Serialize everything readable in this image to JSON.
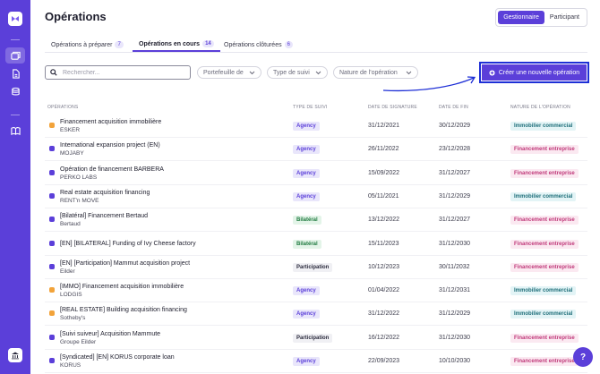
{
  "colors": {
    "accent": "#5b3fd9",
    "highlight": "#1e2fd6",
    "agency_bg": "#e9e6fb",
    "agency_fg": "#5b3fd9",
    "bilateral_bg": "#e3f4e8",
    "bilateral_fg": "#1f7a3f",
    "participation_bg": "#f0f0f4",
    "participation_fg": "#2a2a3c",
    "immo_bg": "#e3f4f6",
    "immo_fg": "#1f6f7a",
    "finent_bg": "#fbe9f1",
    "finent_fg": "#c0397a",
    "icon_orange": "#f2a33a",
    "icon_purple": "#5b3fd9"
  },
  "sidebar": {
    "logo_icon": "logo-icon",
    "items": [
      {
        "icon": "operations-icon",
        "active": true
      },
      {
        "icon": "document-icon",
        "active": false
      },
      {
        "icon": "database-icon",
        "active": false
      },
      {
        "icon": "book-icon",
        "active": false
      }
    ],
    "bottom_icon": "bank-icon"
  },
  "page": {
    "title": "Opérations"
  },
  "role_toggle": {
    "options": [
      "Gestionnaire",
      "Participant"
    ],
    "selected": "Gestionnaire"
  },
  "tabs": [
    {
      "label": "Opérations à préparer",
      "count": "7"
    },
    {
      "label": "Opérations en cours",
      "count": "14",
      "active": true
    },
    {
      "label": "Opérations clôturées",
      "count": "6"
    }
  ],
  "search": {
    "placeholder": "Rechercher..."
  },
  "filters": [
    "Portefeuille de",
    "Type de suivi",
    "Nature de l'opération"
  ],
  "cta": {
    "label": "Créer une nouvelle opération"
  },
  "table": {
    "columns": [
      "OPÉRATIONS",
      "TYPE DE SUIVI",
      "DATE DE SIGNATURE",
      "DATE DE FIN",
      "NATURE DE L'OPÉRATION"
    ],
    "rows": [
      {
        "name": "Financement acquisition immobilière",
        "sub": "ESKER",
        "icon": "orange",
        "type": "Agency",
        "sign": "31/12/2021",
        "end": "30/12/2029",
        "nature": "Immobilier commercial"
      },
      {
        "name": "International expansion project (EN)",
        "sub": "MOJABY",
        "icon": "purple",
        "type": "Agency",
        "sign": "26/11/2022",
        "end": "23/12/2028",
        "nature": "Financement entreprise"
      },
      {
        "name": "Opération de financement BARBERA",
        "sub": "PERKO LABS",
        "icon": "purple",
        "type": "Agency",
        "sign": "15/09/2022",
        "end": "31/12/2027",
        "nature": "Financement entreprise"
      },
      {
        "name": "Real estate acquisition financing",
        "sub": "RENT'n MOVE",
        "icon": "purple",
        "type": "Agency",
        "sign": "05/11/2021",
        "end": "31/12/2029",
        "nature": "Immobilier commercial"
      },
      {
        "name": "[Bilatéral] Financement Bertaud",
        "sub": "Bertaud",
        "icon": "purple",
        "type": "Bilatéral",
        "sign": "13/12/2022",
        "end": "31/12/2027",
        "nature": "Financement entreprise"
      },
      {
        "name": "[EN] [BILATERAL] Funding of Ivy Cheese factory",
        "sub": "",
        "icon": "purple",
        "type": "Bilatéral",
        "sign": "15/11/2023",
        "end": "31/12/2030",
        "nature": "Financement entreprise"
      },
      {
        "name": "[EN] [Participation] Mammut acquisition project",
        "sub": "Eilder",
        "icon": "purple",
        "type": "Participation",
        "sign": "10/12/2023",
        "end": "30/11/2032",
        "nature": "Financement entreprise"
      },
      {
        "name": "[IMMO] Financement acquisition immobilière",
        "sub": "LODGIS",
        "icon": "orange",
        "type": "Agency",
        "sign": "01/04/2022",
        "end": "31/12/2031",
        "nature": "Immobilier commercial"
      },
      {
        "name": "[REAL ESTATE] Building acquisition financing",
        "sub": "Sotheby's",
        "icon": "orange",
        "type": "Agency",
        "sign": "31/12/2022",
        "end": "31/12/2029",
        "nature": "Immobilier commercial"
      },
      {
        "name": "[Suivi suiveur] Acquisition Mammute",
        "sub": "Groupe Eilder",
        "icon": "purple",
        "type": "Participation",
        "sign": "16/12/2022",
        "end": "31/12/2030",
        "nature": "Financement entreprise"
      },
      {
        "name": "[Syndicated] [EN] KORUS corporate loan",
        "sub": "KORUS",
        "icon": "purple",
        "type": "Agency",
        "sign": "22/09/2023",
        "end": "10/10/2030",
        "nature": "Financement entreprise"
      }
    ]
  },
  "help": {
    "label": "?"
  }
}
